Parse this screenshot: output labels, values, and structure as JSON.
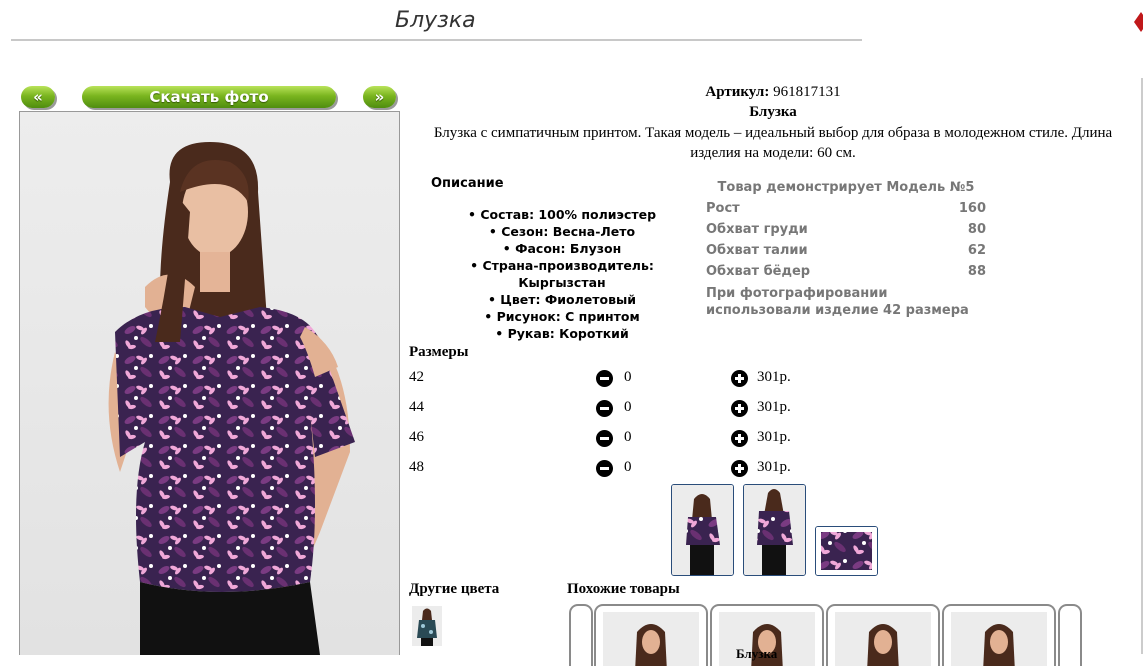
{
  "page": {
    "title": "Блузка"
  },
  "gallery": {
    "prev_label": "«",
    "download_label": "Скачать фото",
    "next_label": "»"
  },
  "product": {
    "article_label": "Артикул:",
    "article_value": "961817131",
    "name": "Блузка",
    "description": "Блузка с симпатичным принтом. Такая модель – идеальный выбор для образа в молодежном стиле. Длина изделия на модели: 60 см."
  },
  "specs": {
    "title": "Описание",
    "items": [
      "Состав: 100% полиэстер",
      "Сезон: Весна-Лето",
      "Фасон: Блузон",
      "Страна-производитель: Кыргызстан",
      "Цвет: Фиолетовый",
      "Рисунок: С принтом",
      "Рукав: Короткий"
    ]
  },
  "model": {
    "heading": "Товар демонстрирует Модель №5",
    "rows": [
      {
        "label": "Рост",
        "value": "160"
      },
      {
        "label": "Обхват груди",
        "value": "80"
      },
      {
        "label": "Обхват талии",
        "value": "62"
      },
      {
        "label": "Обхват бёдер",
        "value": "88"
      }
    ],
    "note": "При фотографировании использовали изделие 42 размера"
  },
  "sizes": {
    "title": "Размеры",
    "rows": [
      {
        "size": "42",
        "qty": "0",
        "price": "301р."
      },
      {
        "size": "44",
        "qty": "0",
        "price": "301р."
      },
      {
        "size": "46",
        "qty": "0",
        "price": "301р."
      },
      {
        "size": "48",
        "qty": "0",
        "price": "301р."
      }
    ]
  },
  "sections": {
    "other_colors": "Другие цвета",
    "similar": "Похожие товары",
    "similar_caption": "Блузка"
  },
  "colors": {
    "button_green": "#7ab51f",
    "thumb_border": "#2a4d7a",
    "print_purple": "#5a2a5e",
    "print_pink": "#f0a8d8"
  }
}
